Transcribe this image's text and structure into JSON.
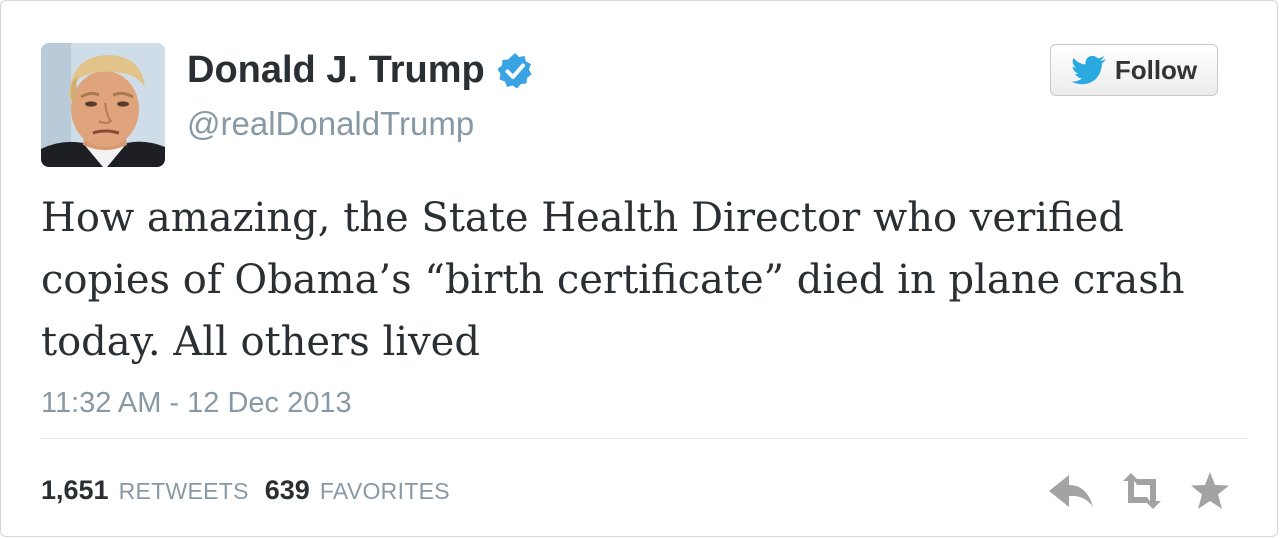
{
  "tweet": {
    "display_name": "Donald J. Trump",
    "username": "@realDonaldTrump",
    "verified": true,
    "text": "How amazing, the State Health Director who verified copies of Obama’s “birth certificate” died in plane crash today. All others lived",
    "timestamp": "11:32 AM - 12 Dec 2013"
  },
  "follow_button": {
    "label": "Follow",
    "icon": "twitter-bird-icon"
  },
  "stats": {
    "retweets_count": "1,651",
    "retweets_label": "RETWEETS",
    "favorites_count": "639",
    "favorites_label": "FAVORITES"
  },
  "actions": {
    "icons": [
      "reply-icon",
      "retweet-icon",
      "favorite-star-icon"
    ]
  },
  "colors": {
    "verified": "#1da1f2",
    "text": "#292f33",
    "muted": "#8899a6",
    "icon_gray": "#a9a9a9",
    "twitter_blue": "#2aa9e0"
  }
}
